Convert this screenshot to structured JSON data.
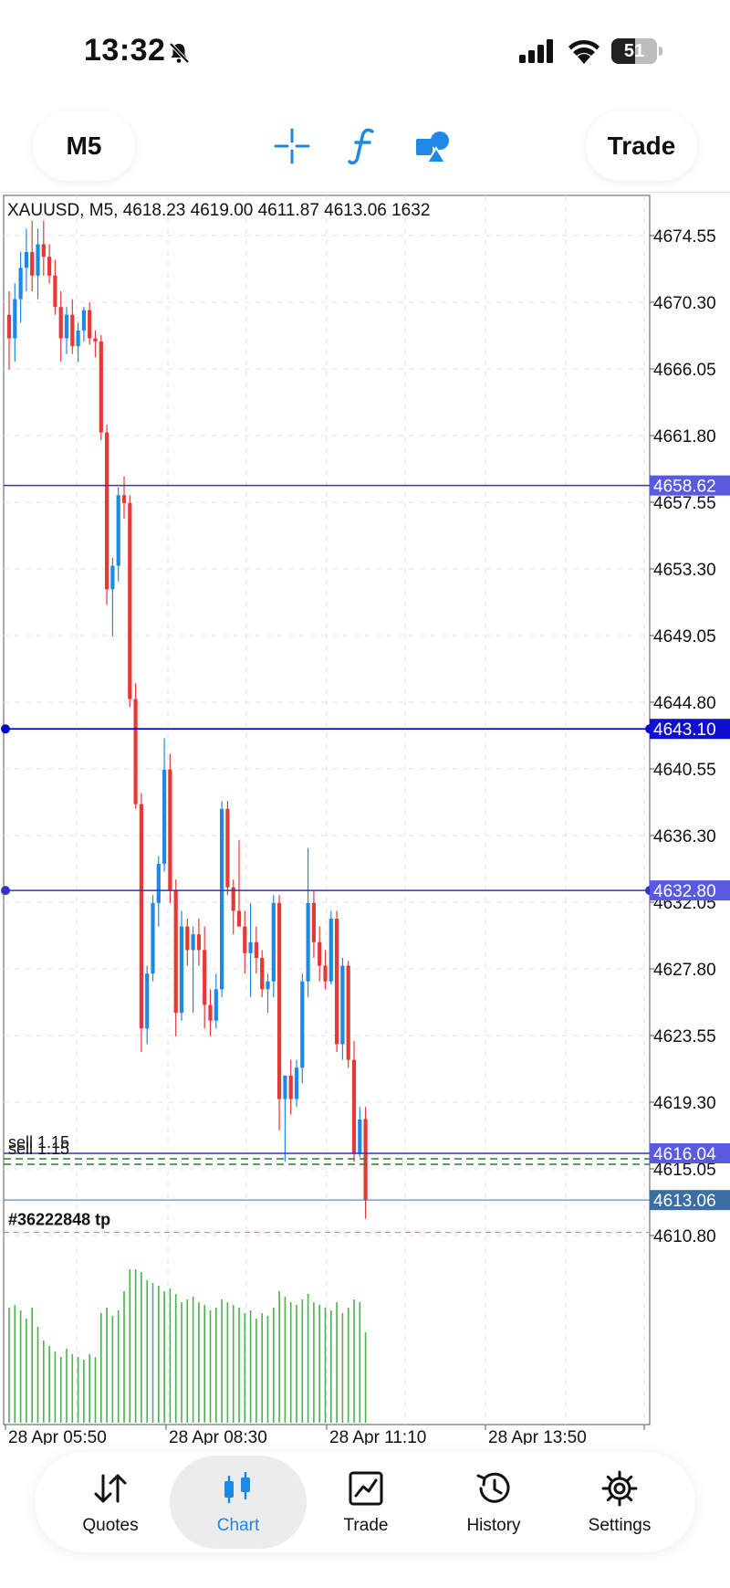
{
  "status_bar": {
    "time": "13:32",
    "battery": "51"
  },
  "toolbar": {
    "timeframe": "M5",
    "trade_label": "Trade",
    "icons": [
      "crosshair-icon",
      "function-icon",
      "shapes-icon"
    ],
    "accent": "#1e88e5"
  },
  "chart_info": {
    "symbol": "XAUUSD",
    "timeframe": "M5",
    "open": "4618.23",
    "high": "4619.00",
    "low": "4611.87",
    "close": "4613.06",
    "volume": "1632",
    "text": "XAUUSD, M5, 4618.23 4619.00 4611.87 4613.06 1632"
  },
  "chart_data": {
    "type": "candlestick",
    "price_ticks": [
      "4674.55",
      "4670.30",
      "4666.05",
      "4661.80",
      "4657.55",
      "4653.30",
      "4649.05",
      "4644.80",
      "4640.55",
      "4636.30",
      "4632.05",
      "4627.80",
      "4623.55",
      "4619.30",
      "4615.05",
      "4610.80"
    ],
    "time_ticks": [
      "28 Apr 05:50",
      "28 Apr 08:30",
      "28 Apr 11:10",
      "28 Apr 13:50"
    ],
    "horizontal_lines": [
      {
        "price": 4658.62,
        "label": "4658.62",
        "color": "#3333cc"
      },
      {
        "price": 4643.1,
        "label": "4643.10",
        "color": "#0000cc"
      },
      {
        "price": 4632.8,
        "label": "4632.80",
        "color": "#3333cc"
      },
      {
        "price": 4616.04,
        "label": "4616.04",
        "color": "#3333cc"
      },
      {
        "price": 4613.06,
        "label": "4613.06",
        "color": "#3a6ea5"
      }
    ],
    "order_labels": [
      "sell 1.15",
      "sell 1.15"
    ],
    "order_id_label": "#36222848 tp",
    "tp_price": 4611.0,
    "bull_color": "#1e88e5",
    "bear_color": "#e53935",
    "volume_color": "#4caf50",
    "candles": [
      [
        4669.5,
        4671,
        4666,
        4668
      ],
      [
        4668,
        4671.5,
        4666.5,
        4670.5
      ],
      [
        4670.5,
        4673.5,
        4669,
        4672.5
      ],
      [
        4672.5,
        4675,
        4671,
        4673.5
      ],
      [
        4673.5,
        4675.5,
        4671,
        4672
      ],
      [
        4672,
        4675,
        4670.5,
        4674
      ],
      [
        4674,
        4675.5,
        4672,
        4673.2
      ],
      [
        4673.2,
        4674,
        4671.5,
        4672
      ],
      [
        4672,
        4673,
        4669.5,
        4670
      ],
      [
        4670,
        4671,
        4666.5,
        4668
      ],
      [
        4668,
        4670,
        4667,
        4669.5
      ],
      [
        4669.5,
        4670.5,
        4667,
        4667.5
      ],
      [
        4667.5,
        4669,
        4666.5,
        4668.5
      ],
      [
        4668.5,
        4670,
        4667.8,
        4669.8
      ],
      [
        4669.8,
        4670.3,
        4667.6,
        4668
      ],
      [
        4668,
        4668.5,
        4666.8,
        4667.8
      ],
      [
        4667.8,
        4668.2,
        4661.5,
        4662
      ],
      [
        4662,
        4662.5,
        4651,
        4652
      ],
      [
        4652,
        4654,
        4649,
        4653.5
      ],
      [
        4653.5,
        4658.5,
        4652.5,
        4658
      ],
      [
        4658,
        4659.2,
        4656.5,
        4657.5
      ],
      [
        4657.5,
        4658,
        4644.5,
        4645
      ],
      [
        4645,
        4646,
        4638,
        4638.3
      ],
      [
        4638.3,
        4639,
        4622.5,
        4624
      ],
      [
        4624,
        4628,
        4623,
        4627.5
      ],
      [
        4627.5,
        4632.5,
        4627,
        4632
      ],
      [
        4632,
        4635,
        4630.5,
        4634.5
      ],
      [
        4634.5,
        4642.5,
        4634,
        4640.5
      ],
      [
        4640.5,
        4641.5,
        4632,
        4632.8
      ],
      [
        4632.8,
        4633.5,
        4623.5,
        4625
      ],
      [
        4625,
        4631.5,
        4624.5,
        4630.5
      ],
      [
        4630.5,
        4631,
        4628,
        4629
      ],
      [
        4629,
        4630.5,
        4625,
        4630
      ],
      [
        4630,
        4631,
        4628,
        4629
      ],
      [
        4629,
        4630.5,
        4624,
        4625.5
      ],
      [
        4625.5,
        4626.5,
        4623.5,
        4624.5
      ],
      [
        4624.5,
        4627.5,
        4624,
        4626.5
      ],
      [
        4626.5,
        4638.5,
        4626,
        4638
      ],
      [
        4638,
        4638.5,
        4632.5,
        4633
      ],
      [
        4633,
        4633.5,
        4630,
        4631.5
      ],
      [
        4631.5,
        4636,
        4630.5,
        4630.5
      ],
      [
        4630.5,
        4631.5,
        4627.5,
        4628.8
      ],
      [
        4628.8,
        4632,
        4626,
        4629.5
      ],
      [
        4629.5,
        4630.5,
        4627.5,
        4628.5
      ],
      [
        4628.5,
        4629,
        4626,
        4626.5
      ],
      [
        4626.5,
        4627.5,
        4625,
        4627
      ],
      [
        4627,
        4632.5,
        4626,
        4632
      ],
      [
        4632,
        4632.5,
        4617.5,
        4619.5
      ],
      [
        4619.5,
        4621,
        4615.5,
        4621
      ],
      [
        4621,
        4622,
        4618.5,
        4619.5
      ],
      [
        4619.5,
        4622,
        4619,
        4621.5
      ],
      [
        4621.5,
        4627.5,
        4620.5,
        4627
      ],
      [
        4627,
        4635.5,
        4626,
        4632
      ],
      [
        4632,
        4632.8,
        4628.5,
        4629.5
      ],
      [
        4629.5,
        4630.5,
        4627,
        4628
      ],
      [
        4628,
        4629,
        4626.5,
        4627
      ],
      [
        4627,
        4631.5,
        4626.8,
        4631
      ],
      [
        4631,
        4631.5,
        4622.5,
        4623
      ],
      [
        4623,
        4628.5,
        4622,
        4628
      ],
      [
        4628,
        4628.3,
        4621.5,
        4622
      ],
      [
        4622,
        4623.2,
        4615.5,
        4616
      ],
      [
        4616,
        4619,
        4615.8,
        4618.2
      ],
      [
        4618.23,
        4619.0,
        4611.87,
        4613.06
      ]
    ],
    "volumes": [
      420,
      430,
      410,
      380,
      420,
      350,
      300,
      280,
      260,
      240,
      270,
      250,
      240,
      230,
      250,
      240,
      400,
      420,
      390,
      410,
      480,
      560,
      560,
      550,
      520,
      510,
      500,
      480,
      490,
      470,
      440,
      450,
      460,
      440,
      430,
      410,
      420,
      450,
      440,
      430,
      420,
      400,
      410,
      380,
      400,
      390,
      420,
      480,
      460,
      440,
      430,
      450,
      470,
      440,
      430,
      420,
      410,
      440,
      400,
      420,
      450,
      440,
      330
    ]
  },
  "bottom_nav": {
    "items": [
      {
        "label": "Quotes",
        "icon": "quotes-arrows-icon"
      },
      {
        "label": "Chart",
        "icon": "candlestick-chart-icon"
      },
      {
        "label": "Trade",
        "icon": "trade-chart-icon"
      },
      {
        "label": "History",
        "icon": "history-icon"
      },
      {
        "label": "Settings",
        "icon": "settings-gear-icon"
      }
    ],
    "active": "Chart"
  }
}
